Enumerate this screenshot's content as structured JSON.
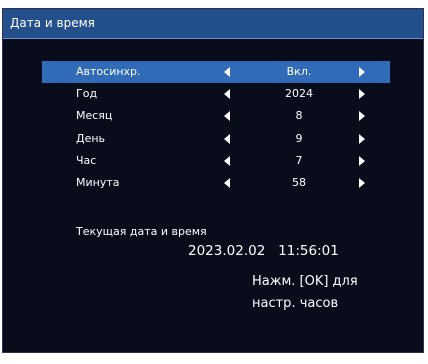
{
  "window": {
    "title": "Дата и время"
  },
  "settings": [
    {
      "label": "Автосинхр.",
      "value": "Вкл.",
      "selected": true
    },
    {
      "label": "Год",
      "value": "2024",
      "selected": false
    },
    {
      "label": "Месяц",
      "value": "8",
      "selected": false
    },
    {
      "label": "День",
      "value": "9",
      "selected": false
    },
    {
      "label": "Час",
      "value": "7",
      "selected": false
    },
    {
      "label": "Минута",
      "value": "58",
      "selected": false
    }
  ],
  "current": {
    "label": "Текущая дата и время",
    "date": "2023.02.02",
    "time": "11:56:01"
  },
  "hint": {
    "line1": "Нажм. [OK] для",
    "line2": "настр. часов"
  },
  "icons": {
    "decrease": "left-arrow-icon",
    "increase": "right-arrow-icon"
  },
  "colors": {
    "background": "#080c1b",
    "titlebar": "#23508c",
    "selection": "#2f6bb6",
    "text": "#ffffff"
  }
}
